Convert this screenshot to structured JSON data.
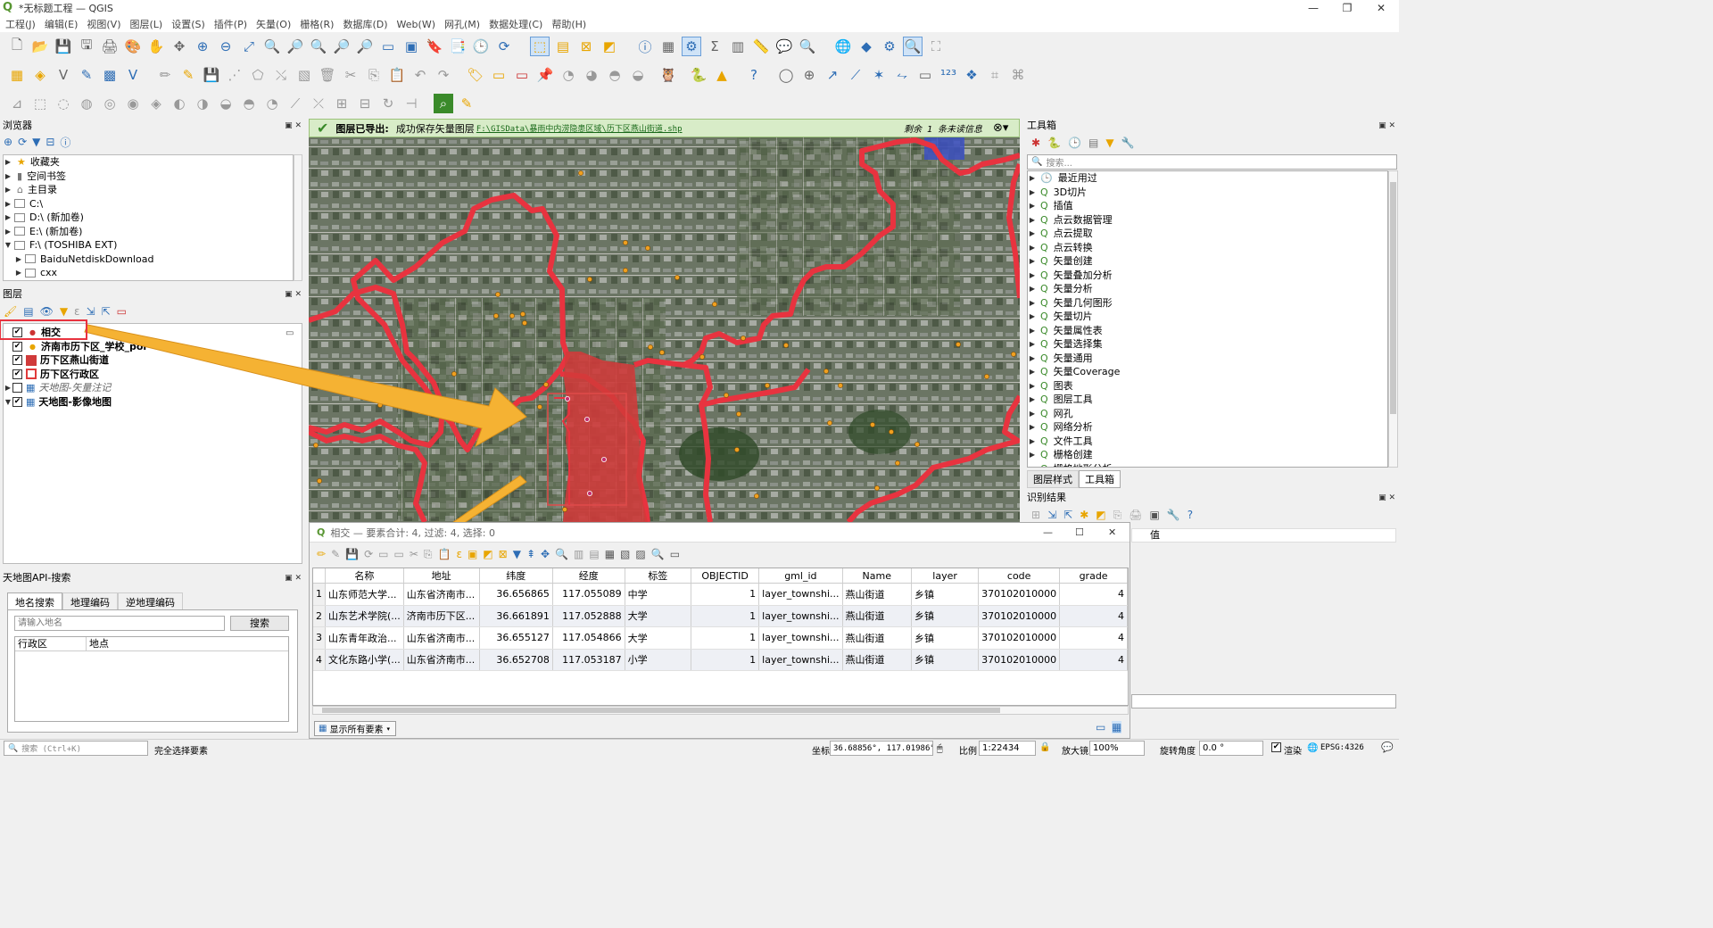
{
  "window": {
    "title": "*无标题工程 — QGIS",
    "minimize": "—",
    "maximize": "❐",
    "close": "✕"
  },
  "menu": [
    "工程(J)",
    "编辑(E)",
    "视图(V)",
    "图层(L)",
    "设置(S)",
    "插件(P)",
    "矢量(O)",
    "栅格(R)",
    "数据库(D)",
    "Web(W)",
    "网孔(M)",
    "数据处理(C)",
    "帮助(H)"
  ],
  "browser": {
    "title": "浏览器",
    "items": [
      {
        "label": "收藏夹"
      },
      {
        "label": "空间书签"
      },
      {
        "label": "主目录"
      },
      {
        "label": "C:\\"
      },
      {
        "label": "D:\\ (新加卷)"
      },
      {
        "label": "E:\\ (新加卷)"
      },
      {
        "label": "F:\\ (TOSHIBA EXT)"
      },
      {
        "label": "BaiduNetdiskDownload"
      },
      {
        "label": "cxx"
      }
    ]
  },
  "layers": {
    "title": "图层",
    "items": [
      {
        "label": "相交",
        "checked": true
      },
      {
        "label": "济南市历下区_学校_poi",
        "checked": true
      },
      {
        "label": "历下区燕山街道",
        "checked": true
      },
      {
        "label": "历下区行政区",
        "checked": true
      },
      {
        "label": "天地图-矢量注记",
        "checked": false
      },
      {
        "label": "天地图-影像地图",
        "checked": true
      }
    ]
  },
  "tianditu": {
    "title": "天地图API-搜索",
    "tabs": [
      "地名搜索",
      "地理编码",
      "逆地理编码"
    ],
    "placeholder": "请输入地名",
    "search_btn": "搜索",
    "col1": "行政区",
    "col2": "地点"
  },
  "msgbar": {
    "label": "图层已导出:",
    "text": "成功保存矢量图层",
    "link": "F:\\GISData\\暴雨中内涝隐患区域\\历下区燕山街道.shp",
    "more": "剩余 1 条未读信息"
  },
  "attr": {
    "title": "相交 — 要素合计: 4, 过滤: 4, 选择: 0",
    "columns": [
      "名称",
      "地址",
      "纬度",
      "经度",
      "标签",
      "OBJECTID",
      "gml_id",
      "Name",
      "layer",
      "code",
      "grade"
    ],
    "rows": [
      [
        "山东师范大学...",
        "山东省济南市...",
        "36.656865",
        "117.055089",
        "中学",
        "1",
        "layer_townshi...",
        "燕山街道",
        "乡镇",
        "370102010000",
        "4"
      ],
      [
        "山东艺术学院(...",
        "济南市历下区...",
        "36.661891",
        "117.052888",
        "大学",
        "1",
        "layer_townshi...",
        "燕山街道",
        "乡镇",
        "370102010000",
        "4"
      ],
      [
        "山东青年政治...",
        "山东省济南市...",
        "36.655127",
        "117.054866",
        "大学",
        "1",
        "layer_townshi...",
        "燕山街道",
        "乡镇",
        "370102010000",
        "4"
      ],
      [
        "文化东路小学(...",
        "山东省济南市...",
        "36.652708",
        "117.053187",
        "小学",
        "1",
        "layer_townshi...",
        "燕山街道",
        "乡镇",
        "370102010000",
        "4"
      ]
    ],
    "show_all": "显示所有要素"
  },
  "toolbox": {
    "title": "工具箱",
    "search": "搜索...",
    "items": [
      "最近用过",
      "3D切片",
      "插值",
      "点云数据管理",
      "点云提取",
      "点云转换",
      "矢量创建",
      "矢量叠加分析",
      "矢量分析",
      "矢量几何图形",
      "矢量切片",
      "矢量属性表",
      "矢量选择集",
      "矢量通用",
      "矢量Coverage",
      "图表",
      "图层工具",
      "网孔",
      "网络分析",
      "文件工具",
      "栅格创建",
      "栅格地形分析"
    ],
    "tabs": [
      "图层样式",
      "工具箱"
    ]
  },
  "identify": {
    "title": "识别结果",
    "col": "值"
  },
  "status": {
    "search": "搜索 (Ctrl+K)",
    "msg": "完全选择要素",
    "coord_label": "坐标",
    "coord": "36.68856°, 117.01986°",
    "scale_label": "比例",
    "scale": "1:22434",
    "mag_label": "放大镜",
    "mag": "100%",
    "rot_label": "旋转角度",
    "rot": "0.0 °",
    "render": "渲染",
    "crs": "EPSG:4326"
  }
}
